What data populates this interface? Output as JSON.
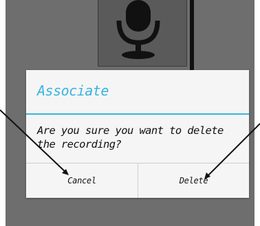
{
  "dialog": {
    "title": "Associate",
    "message": "Are you sure you want to delete the recording?",
    "cancel_label": "Cancel",
    "delete_label": "Delete"
  },
  "icons": {
    "background": "microphone-icon"
  },
  "colors": {
    "accent": "#37b4e0",
    "scrim": "#6e6e6e",
    "dialog_bg": "#f5f5f5"
  }
}
